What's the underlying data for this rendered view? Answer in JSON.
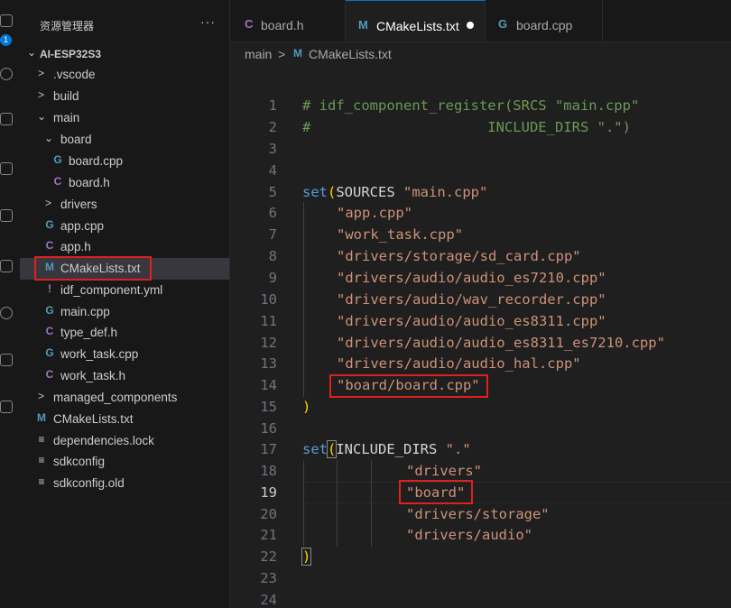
{
  "activity_bar": {
    "badge": "1"
  },
  "explorer": {
    "title": "资源管理器",
    "more": "···",
    "root": "AI-ESP32S3",
    "items": [
      {
        "label": ".vscode",
        "icon": "chevron-right",
        "type": "folder"
      },
      {
        "label": "build",
        "icon": "chevron-right",
        "type": "folder"
      },
      {
        "label": "main",
        "icon": "chevron-down",
        "type": "folder"
      },
      {
        "label": "board",
        "icon": "chevron-down",
        "type": "folder"
      },
      {
        "label": "board.cpp",
        "icon": "C++",
        "type": "file"
      },
      {
        "label": "board.h",
        "icon": "C",
        "type": "file"
      },
      {
        "label": "drivers",
        "icon": "chevron-right",
        "type": "folder"
      },
      {
        "label": "app.cpp",
        "icon": "C++",
        "type": "file"
      },
      {
        "label": "app.h",
        "icon": "C",
        "type": "file"
      },
      {
        "label": "CMakeLists.txt",
        "icon": "M",
        "type": "file"
      },
      {
        "label": "idf_component.yml",
        "icon": "!",
        "type": "file"
      },
      {
        "label": "main.cpp",
        "icon": "C++",
        "type": "file"
      },
      {
        "label": "type_def.h",
        "icon": "C",
        "type": "file"
      },
      {
        "label": "work_task.cpp",
        "icon": "C++",
        "type": "file"
      },
      {
        "label": "work_task.h",
        "icon": "C",
        "type": "file"
      },
      {
        "label": "managed_components",
        "icon": "chevron-right",
        "type": "folder"
      },
      {
        "label": "CMakeLists.txt",
        "icon": "M",
        "type": "file"
      },
      {
        "label": "dependencies.lock",
        "icon": "lines",
        "type": "file"
      },
      {
        "label": "sdkconfig",
        "icon": "lines",
        "type": "file"
      },
      {
        "label": "sdkconfig.old",
        "icon": "lines",
        "type": "file"
      }
    ]
  },
  "tabs": [
    {
      "label": "board.h",
      "icon": "C"
    },
    {
      "label": "CMakeLists.txt",
      "icon": "M"
    },
    {
      "label": "board.cpp",
      "icon": "C++"
    }
  ],
  "breadcrumb": {
    "part1": "main",
    "sep": ">",
    "icon": "M",
    "part2": "CMakeLists.txt"
  },
  "editor": {
    "line_numbers": [
      "1",
      "2",
      "3",
      "4",
      "5",
      "6",
      "7",
      "8",
      "9",
      "10",
      "11",
      "12",
      "13",
      "14",
      "15",
      "16",
      "17",
      "18",
      "19",
      "20",
      "21",
      "22",
      "23",
      "24"
    ],
    "lines": {
      "l1": "# idf_component_register(SRCS \"main.cpp\"",
      "l2": "#                     INCLUDE_DIRS \".\")",
      "l5_fn": "set",
      "l5_paren": "(",
      "l5_txt": "SOURCES ",
      "l5_str": "\"main.cpp\"",
      "l6": "\"app.cpp\"",
      "l7": "\"work_task.cpp\"",
      "l8": "\"drivers/storage/sd_card.cpp\"",
      "l9": "\"drivers/audio/audio_es7210.cpp\"",
      "l10": "\"drivers/audio/wav_recorder.cpp\"",
      "l11": "\"drivers/audio/audio_es8311.cpp\"",
      "l12": "\"drivers/audio/audio_es8311_es7210.cpp\"",
      "l13": "\"drivers/audio/audio_hal.cpp\"",
      "l14": "\"board/board.cpp\"",
      "l15": ")",
      "l17_fn": "set",
      "l17_paren": "(",
      "l17_txt": "INCLUDE_DIRS ",
      "l17_str": "\".\"",
      "l18": "\"drivers\"",
      "l19": "\"board\"",
      "l20": "\"drivers/storage\"",
      "l21": "\"drivers/audio\"",
      "l22": ")"
    }
  },
  "colors": {
    "accent": "#0078d4",
    "highlight_box": "#e02020",
    "cpp_icon": "#519aba",
    "c_icon": "#a074c4",
    "m_icon": "#519aba",
    "yml_icon": "#a074c4"
  }
}
